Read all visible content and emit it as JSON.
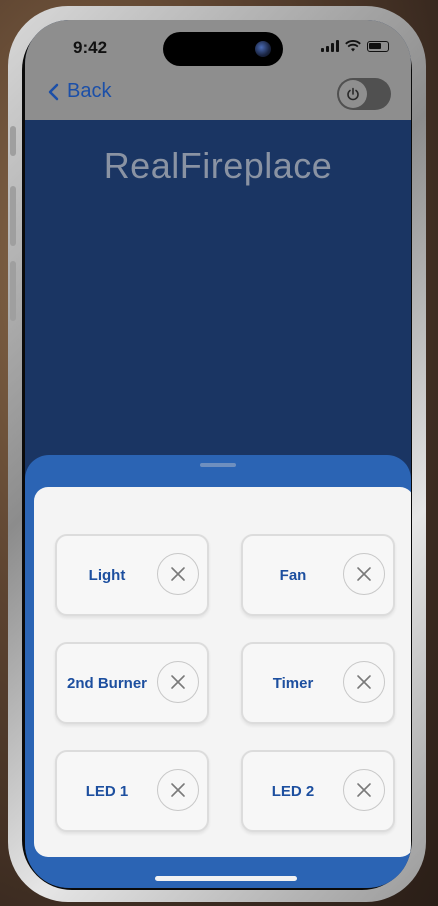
{
  "status_bar": {
    "time": "9:42"
  },
  "nav": {
    "back_label": "Back"
  },
  "app": {
    "title": "RealFireplace"
  },
  "controls": [
    {
      "label": "Light"
    },
    {
      "label": "Fan"
    },
    {
      "label": "2nd Burner"
    },
    {
      "label": "Timer"
    },
    {
      "label": "LED 1"
    },
    {
      "label": "LED 2"
    }
  ],
  "colors": {
    "screen_bg": "#1a3563",
    "sheet_bg": "#2b64b4",
    "accent_blue": "#1b4fa8",
    "panel_bg": "#f4f4f4"
  },
  "icons": {
    "back": "chevron-left-icon",
    "power": "power-icon",
    "remove": "close-icon"
  }
}
